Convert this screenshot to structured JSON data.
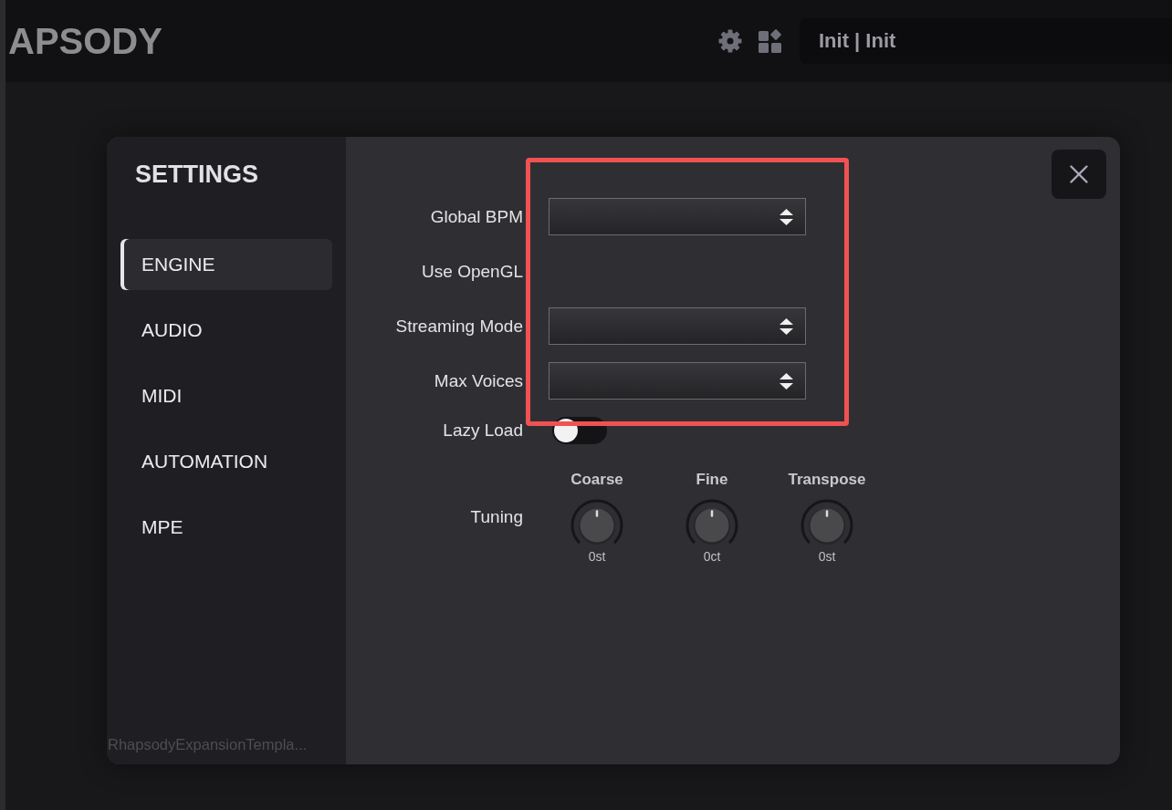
{
  "header": {
    "brand": "APSODY",
    "preset": "Init | Init"
  },
  "settings": {
    "title": "SETTINGS",
    "nav": [
      {
        "label": "ENGINE",
        "selected": true
      },
      {
        "label": "AUDIO",
        "selected": false
      },
      {
        "label": "MIDI",
        "selected": false
      },
      {
        "label": "AUTOMATION",
        "selected": false
      },
      {
        "label": "MPE",
        "selected": false
      }
    ],
    "footer": "RhapsodyExpansionTempla...",
    "rows": [
      {
        "label": "Global BPM",
        "kind": "dropdown"
      },
      {
        "label": "Use OpenGL",
        "kind": "label"
      },
      {
        "label": "Streaming Mode",
        "kind": "dropdown"
      },
      {
        "label": "Max Voices",
        "kind": "dropdown"
      },
      {
        "label": "Lazy Load",
        "kind": "toggle",
        "on": false
      }
    ],
    "tuning": {
      "label": "Tuning",
      "knobs": [
        {
          "label": "Coarse",
          "value": "0st",
          "level": 0.5
        },
        {
          "label": "Fine",
          "value": "0ct",
          "level": 0.5
        },
        {
          "label": "Transpose",
          "value": "0st",
          "level": 0.5
        }
      ]
    }
  },
  "annotation": {
    "kind": "frame"
  }
}
